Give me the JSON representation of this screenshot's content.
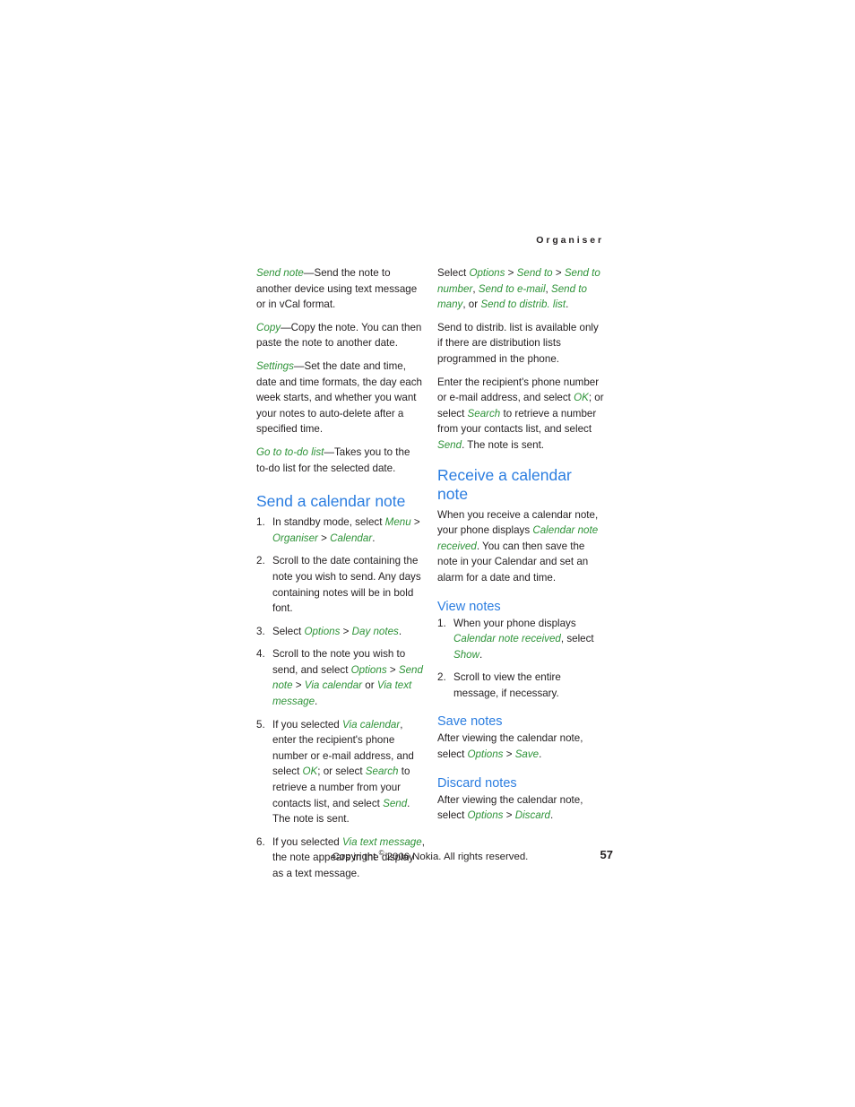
{
  "header": {
    "running_head": "Organiser"
  },
  "left_column": {
    "paragraphs": [
      {
        "id": "send-note",
        "runs": [
          {
            "text": "Send note",
            "style": "ui"
          },
          {
            "text": "—Send the note to another device using text message or in vCal format.",
            "style": "plain"
          }
        ]
      },
      {
        "id": "copy",
        "runs": [
          {
            "text": "Copy",
            "style": "ui"
          },
          {
            "text": "—Copy the note. You can then paste the note to another date.",
            "style": "plain"
          }
        ]
      },
      {
        "id": "settings",
        "runs": [
          {
            "text": "Settings",
            "style": "ui"
          },
          {
            "text": "—Set the date and time, date and time formats, the day each week starts, and whether you want your notes to auto-delete after a specified time.",
            "style": "plain"
          }
        ]
      },
      {
        "id": "go-to-to-do-list",
        "runs": [
          {
            "text": "Go to to-do list",
            "style": "ui"
          },
          {
            "text": "—Takes you to the to-do list for the selected date.",
            "style": "plain"
          }
        ]
      }
    ],
    "heading_send_calendar_note": "Send a calendar note",
    "steps": [
      {
        "number": "1.",
        "runs": [
          {
            "text": "In standby mode, select ",
            "style": "plain"
          },
          {
            "text": "Menu",
            "style": "ui"
          },
          {
            "text": " > ",
            "style": "plain"
          },
          {
            "text": "Organiser",
            "style": "ui"
          },
          {
            "text": " > ",
            "style": "plain"
          },
          {
            "text": "Calendar",
            "style": "ui"
          },
          {
            "text": ".",
            "style": "plain"
          }
        ]
      },
      {
        "number": "2.",
        "runs": [
          {
            "text": "Scroll to the date containing the note you wish to send. Any days containing notes will be in bold font.",
            "style": "plain"
          }
        ]
      },
      {
        "number": "3.",
        "runs": [
          {
            "text": "Select ",
            "style": "plain"
          },
          {
            "text": "Options",
            "style": "ui"
          },
          {
            "text": " > ",
            "style": "plain"
          },
          {
            "text": "Day notes",
            "style": "ui"
          },
          {
            "text": ".",
            "style": "plain"
          }
        ]
      },
      {
        "number": "4.",
        "runs": [
          {
            "text": "Scroll to the note you wish to send, and select ",
            "style": "plain"
          },
          {
            "text": "Options",
            "style": "ui"
          },
          {
            "text": " > ",
            "style": "plain"
          },
          {
            "text": "Send note",
            "style": "ui"
          },
          {
            "text": " > ",
            "style": "plain"
          },
          {
            "text": "Via calendar",
            "style": "ui"
          },
          {
            "text": " or ",
            "style": "plain"
          },
          {
            "text": "Via text message",
            "style": "ui"
          },
          {
            "text": ".",
            "style": "plain"
          }
        ]
      },
      {
        "number": "5.",
        "runs": [
          {
            "text": "If you selected ",
            "style": "plain"
          },
          {
            "text": "Via calendar",
            "style": "ui"
          },
          {
            "text": ", enter the recipient's phone number or e-mail address, and select ",
            "style": "plain"
          },
          {
            "text": "OK",
            "style": "ui"
          },
          {
            "text": "; or select ",
            "style": "plain"
          },
          {
            "text": "Search",
            "style": "ui"
          },
          {
            "text": " to retrieve a number from your contacts list, and select ",
            "style": "plain"
          },
          {
            "text": "Send",
            "style": "ui"
          },
          {
            "text": ". The note is sent.",
            "style": "plain"
          }
        ]
      },
      {
        "number": "6.",
        "runs": [
          {
            "text": "If you selected ",
            "style": "plain"
          },
          {
            "text": "Via text message",
            "style": "ui"
          },
          {
            "text": ", the note appears in the display as a text message.",
            "style": "plain"
          }
        ]
      }
    ]
  },
  "right_column": {
    "paragraphs_top": [
      {
        "id": "select-options-send-to",
        "runs": [
          {
            "text": "Select ",
            "style": "plain"
          },
          {
            "text": "Options",
            "style": "ui"
          },
          {
            "text": " > ",
            "style": "plain"
          },
          {
            "text": "Send to",
            "style": "ui"
          },
          {
            "text": " > ",
            "style": "plain"
          },
          {
            "text": "Send to number",
            "style": "ui"
          },
          {
            "text": ", ",
            "style": "plain"
          },
          {
            "text": "Send to e-mail",
            "style": "ui"
          },
          {
            "text": ", ",
            "style": "plain"
          },
          {
            "text": "Send to many",
            "style": "ui"
          },
          {
            "text": ", or ",
            "style": "plain"
          },
          {
            "text": "Send to distrib. list",
            "style": "ui"
          },
          {
            "text": ".",
            "style": "plain"
          }
        ]
      },
      {
        "id": "distrib-list-note",
        "runs": [
          {
            "text": "Send to distrib. list is available only if there are distribution lists programmed in the phone.",
            "style": "plain"
          }
        ]
      },
      {
        "id": "enter-recipient",
        "runs": [
          {
            "text": "Enter the recipient's phone number or e-mail address, and select ",
            "style": "plain"
          },
          {
            "text": "OK",
            "style": "ui"
          },
          {
            "text": "; or select ",
            "style": "plain"
          },
          {
            "text": "Search",
            "style": "ui"
          },
          {
            "text": " to retrieve a number from your contacts list, and select ",
            "style": "plain"
          },
          {
            "text": "Send",
            "style": "ui"
          },
          {
            "text": ". The note is sent.",
            "style": "plain"
          }
        ]
      }
    ],
    "heading_receive_calendar_note": "Receive a calendar note",
    "receive_paragraph": {
      "runs": [
        {
          "text": "When you receive a calendar note, your phone displays ",
          "style": "plain"
        },
        {
          "text": "Calendar note received",
          "style": "ui"
        },
        {
          "text": ". You can then save the note in your Calendar and set an alarm for a date and time.",
          "style": "plain"
        }
      ]
    },
    "heading_view_notes": "View notes",
    "view_notes_steps": [
      {
        "number": "1.",
        "runs": [
          {
            "text": "When your phone displays ",
            "style": "plain"
          },
          {
            "text": "Calendar note received",
            "style": "ui"
          },
          {
            "text": ", select ",
            "style": "plain"
          },
          {
            "text": "Show",
            "style": "ui"
          },
          {
            "text": ".",
            "style": "plain"
          }
        ]
      },
      {
        "number": "2.",
        "runs": [
          {
            "text": "Scroll to view the entire message, if necessary.",
            "style": "plain"
          }
        ]
      }
    ],
    "heading_save_notes": "Save notes",
    "save_notes_paragraph": {
      "runs": [
        {
          "text": "After viewing the calendar note, select ",
          "style": "plain"
        },
        {
          "text": "Options",
          "style": "ui"
        },
        {
          "text": " > ",
          "style": "plain"
        },
        {
          "text": "Save",
          "style": "ui"
        },
        {
          "text": ".",
          "style": "plain"
        }
      ]
    },
    "heading_discard_notes": "Discard notes",
    "discard_notes_paragraph": {
      "runs": [
        {
          "text": "After viewing the calendar note, select ",
          "style": "plain"
        },
        {
          "text": "Options",
          "style": "ui"
        },
        {
          "text": " > ",
          "style": "plain"
        },
        {
          "text": "Discard",
          "style": "ui"
        },
        {
          "text": ".",
          "style": "plain"
        }
      ]
    }
  },
  "footer": {
    "copyright_prefix": "Copyright ",
    "copyright_symbol": "©",
    "copyright_rest": " 2006 Nokia. All rights reserved.",
    "page_number": "57"
  },
  "colors": {
    "heading_blue": "#2b7de0",
    "ui_term_green": "#2e9338",
    "body_text": "#231f20",
    "page_background": "#ffffff"
  }
}
